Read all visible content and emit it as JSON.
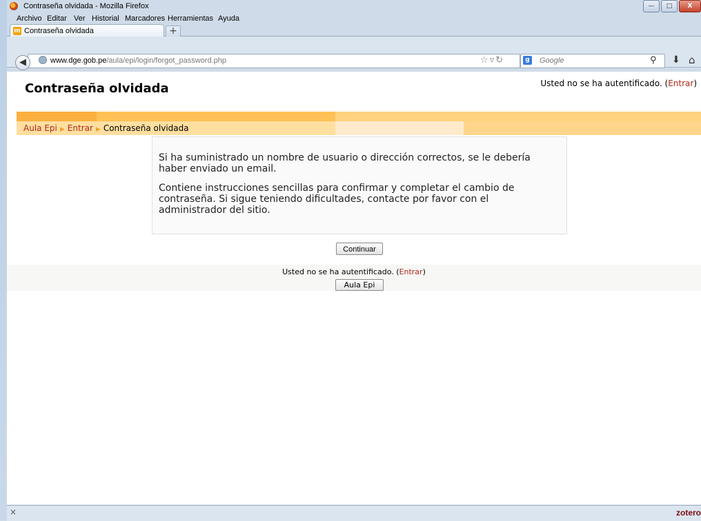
{
  "window": {
    "title": "Contraseña olvidada - Mozilla Firefox",
    "minimize": "—",
    "maximize": "□",
    "close": "X"
  },
  "menu": [
    "Archivo",
    "Editar",
    "Ver",
    "Historial",
    "Marcadores",
    "Herramientas",
    "Ayuda"
  ],
  "tab": {
    "label": "Contraseña olvidada",
    "new_tab": "+"
  },
  "navbar": {
    "url_host": "www.dge.gob.pe",
    "url_path": "/aula/epi/login/forgot_password.php",
    "search_placeholder": "Google"
  },
  "page": {
    "heading": "Contraseña olvidada",
    "login_status": "Usted no se ha autentificado. (",
    "login_link": "Entrar",
    "login_close": ")",
    "breadcrumb": [
      "Aula Epi",
      "Entrar",
      "Contraseña olvidada"
    ],
    "breadcrumb_sep": "▶",
    "notice_p1": "Si ha suministrado un nombre de usuario o dirección correctos, se le debería haber enviado un email.",
    "notice_p2": "Contiene instrucciones sencillas para confirmar y completar el cambio de contraseña. Si sigue teniendo dificultades, contacte por favor con el administrador del sitio.",
    "continue_button": "Continuar",
    "footer_login_status": "Usted no se ha autentificado. (",
    "footer_login_link": "Entrar",
    "footer_login_close": ")",
    "footer_home_button": "Aula Epi"
  },
  "statusbar": {
    "close": "×",
    "zotero": "zotero"
  }
}
